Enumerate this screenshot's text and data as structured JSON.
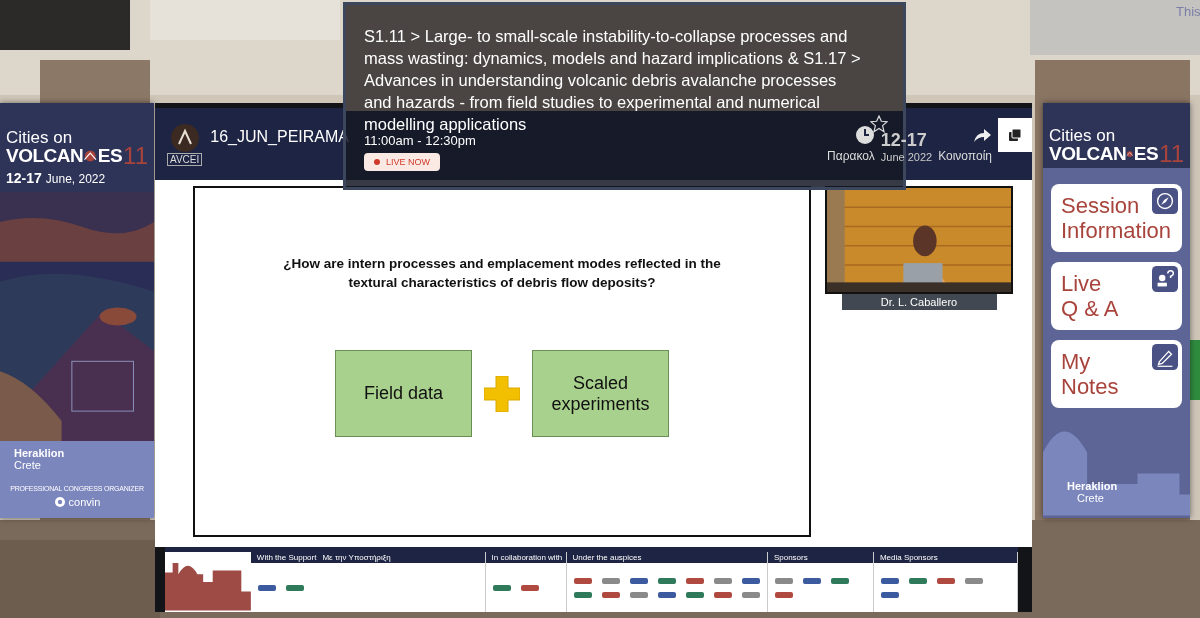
{
  "session_card": {
    "title": "S1.11 > Large- to small-scale instability-to-collapse processes and mass wasting: dynamics, models and hazard implications & S1.17 > Advances in understanding volcanic debris avalanche processes and hazards - from field studies to experimental and numerical modelling applications",
    "favorite": false,
    "time": "11:00am - 12:30pm",
    "badge": "LIVE NOW"
  },
  "left_banner": {
    "title": "Cities on",
    "wordmark": [
      "VOLCAN",
      "ES"
    ],
    "edition": "11",
    "dates": "12-17",
    "month": "June, 2022",
    "city": "Heraklion",
    "region": "Crete",
    "organizer_label": "PROFESSIONAL CONGRESS ORGANIZER",
    "organizer": "convin"
  },
  "video": {
    "title": "16_JUN_PEIRAMA",
    "logo_text": "AVCEI",
    "watch_later": "Παρακολ",
    "share": "Κοινοποίη",
    "dates": "12-17",
    "month": "June 2022"
  },
  "slide": {
    "question": "¿How are intern processes and emplacement modes reflected in the textural characteristics of debris flow deposits?",
    "boxes": [
      "Field data",
      "Scaled experiments"
    ]
  },
  "speaker": {
    "name": "Dr. L. Caballero"
  },
  "sponsor_strip": {
    "sections": [
      {
        "heading": "With the Support",
        "subheading": "Με την Υποστήριξη"
      },
      {
        "heading": "In collaboration with"
      },
      {
        "heading": "Under the auspices"
      },
      {
        "heading": "Sponsors"
      },
      {
        "heading": "Media Sponsors"
      }
    ]
  },
  "right_banner": {
    "title": "Cities on",
    "wordmark": [
      "VOLCAN",
      "ES"
    ],
    "edition": "11",
    "buttons": [
      {
        "lines": [
          "Session",
          "Information"
        ],
        "kind": "compass"
      },
      {
        "lines": [
          "Live",
          "Q & A"
        ],
        "kind": "qa"
      },
      {
        "lines": [
          "My",
          "Notes"
        ],
        "kind": "notes"
      }
    ],
    "city": "Heraklion",
    "region": "Crete"
  },
  "corner_text": "This"
}
